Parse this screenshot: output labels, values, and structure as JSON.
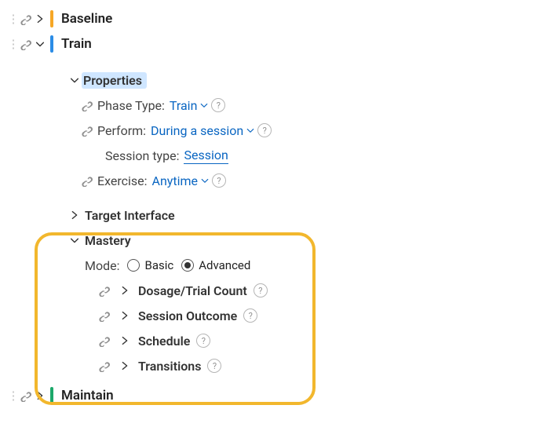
{
  "phases": {
    "baseline": {
      "label": "Baseline"
    },
    "train": {
      "label": "Train"
    },
    "maintain": {
      "label": "Maintain"
    }
  },
  "properties": {
    "heading": "Properties",
    "phase_type": {
      "label": "Phase Type:",
      "value": "Train"
    },
    "perform": {
      "label": "Perform:",
      "value": "During a session"
    },
    "session_type": {
      "label": "Session type:",
      "value": "Session"
    },
    "exercise": {
      "label": "Exercise:",
      "value": "Anytime"
    }
  },
  "target_interface": {
    "label": "Target Interface"
  },
  "mastery": {
    "label": "Mastery",
    "mode_label": "Mode:",
    "mode_basic": "Basic",
    "mode_advanced": "Advanced",
    "mode_value": "Advanced",
    "items": [
      {
        "label": "Dosage/Trial Count"
      },
      {
        "label": "Session Outcome"
      },
      {
        "label": "Schedule"
      },
      {
        "label": "Transitions"
      }
    ]
  },
  "icons": {
    "dots": "⋮",
    "link": "link",
    "chevron_right": ">",
    "chevron_down": "v",
    "help": "?"
  }
}
